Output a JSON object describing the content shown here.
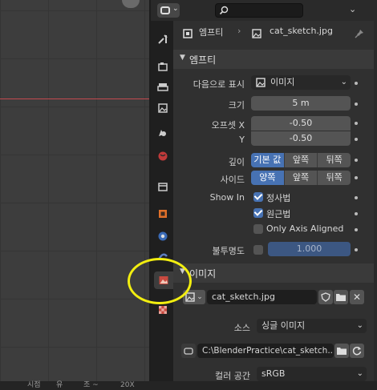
{
  "viewport": {
    "footer_left": "시점",
    "footer_mid1": "유",
    "footer_mid2": "조 ~",
    "footer_right": "20X"
  },
  "header": {
    "search_placeholder": ""
  },
  "breadcrumb": {
    "object": "엠프티",
    "data": "cat_sketch.jpg"
  },
  "empty_panel": {
    "title": "엠프티",
    "display_as_label": "다음으로 표시",
    "display_as_value": "이미지",
    "size_label": "크기",
    "size_value": "5 m",
    "offset_x_label": "오프셋 X",
    "offset_x_value": "-0.50",
    "offset_y_label": "Y",
    "offset_y_value": "-0.50",
    "depth_label": "깊이",
    "depth_options": [
      "기본 값",
      "앞쪽",
      "뒤쪽"
    ],
    "side_label": "사이드",
    "side_options": [
      "양쪽",
      "앞쪽",
      "뒤쪽"
    ],
    "show_in_label": "Show In",
    "orthographic_label": "정사법",
    "perspective_label": "원근법",
    "only_axis_label": "Only Axis Aligned",
    "opacity_label": "불투명도",
    "opacity_value": "1.000"
  },
  "image_panel": {
    "title": "이미지",
    "image_name": "cat_sketch.jpg",
    "source_label": "소스",
    "source_value": "싱글 이미지",
    "filepath": "C:\\BlenderPractice\\cat_sketch....",
    "colorspace_label": "컬러 공간",
    "colorspace_value": "sRGB"
  },
  "colors": {
    "accent": "#4772b3",
    "highlight": "#f2ee10",
    "axis_red": "#c44a4f"
  }
}
